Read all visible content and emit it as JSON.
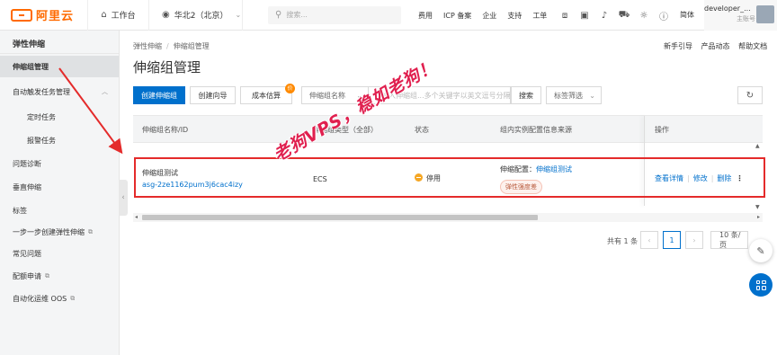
{
  "topbar": {
    "logo_text": "阿里云",
    "workspace": "工作台",
    "region": "华北2（北京）",
    "search_placeholder": "搜索...",
    "links": [
      "费用",
      "ICP 备案",
      "企业",
      "支持",
      "工单"
    ],
    "lang": "简体",
    "user_name": "developer_...",
    "user_role": "主账号"
  },
  "sidebar": {
    "title": "弹性伸缩",
    "items": [
      {
        "label": "伸缩组管理",
        "active": true,
        "external": false
      },
      {
        "label": "自动触发任务管理",
        "active": false,
        "external": false
      },
      {
        "label": "定时任务",
        "active": false,
        "external": false
      },
      {
        "label": "报警任务",
        "active": false,
        "external": false
      },
      {
        "label": "问题诊断",
        "active": false,
        "external": false
      },
      {
        "label": "垂直伸缩",
        "active": false,
        "external": false
      },
      {
        "label": "标签",
        "active": false,
        "external": false
      },
      {
        "label": "一步一步创建弹性伸缩",
        "active": false,
        "external": true
      },
      {
        "label": "常见问题",
        "active": false,
        "external": false
      },
      {
        "label": "配额申请",
        "active": false,
        "external": true
      },
      {
        "label": "自动化运维 OOS",
        "active": false,
        "external": true
      }
    ]
  },
  "breadcrumb": [
    "弹性伸缩",
    "伸缩组管理"
  ],
  "page_title": "伸缩组管理",
  "help_links": [
    "新手引导",
    "产品动态",
    "帮助文档"
  ],
  "toolbar": {
    "create": "创建伸缩组",
    "wizard": "创建向导",
    "cost": "成本估算",
    "cost_badge": "价",
    "filter_select": "伸缩组名称",
    "search_placeholder": "请输入伸缩组...多个关键字以英文逗号分隔...支持模糊查...",
    "search_btn": "搜索",
    "tag_filter": "标签筛选"
  },
  "table": {
    "headers": [
      "伸缩组名称/ID",
      "伸缩组类型（全部）",
      "状态",
      "组内实例配置信息来源",
      "操作"
    ],
    "rows": [
      {
        "name": "伸缩组测试",
        "id": "asg-2ze1162pum3j6cac4izy",
        "type": "ECS",
        "status": "停用",
        "config_label": "伸缩配置：",
        "config_link": "伸缩组测试",
        "config_tag": "弹性强度差",
        "actions": [
          "查看详情",
          "修改",
          "删除"
        ]
      }
    ]
  },
  "pager": {
    "total": "共有 1 条",
    "current": "1",
    "page_size": "10 条/页"
  },
  "watermark": "老狗VPS，稳如老狗！",
  "colors": {
    "brand": "#ff6a00",
    "primary": "#0070cc",
    "annotation": "#e42b2b"
  }
}
